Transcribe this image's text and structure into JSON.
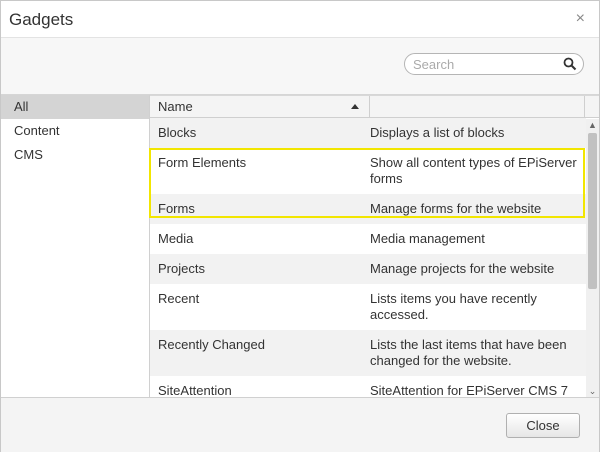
{
  "dialog": {
    "title": "Gadgets",
    "close_glyph": "×"
  },
  "search": {
    "placeholder": "Search",
    "value": ""
  },
  "sidebar": {
    "items": [
      {
        "label": "All",
        "active": true
      },
      {
        "label": "Content",
        "active": false
      },
      {
        "label": "CMS",
        "active": false
      }
    ]
  },
  "table": {
    "columns": {
      "name": "Name",
      "description": ""
    },
    "sort": "ascending",
    "rows": [
      {
        "name": "Blocks",
        "description": "Displays a list of blocks"
      },
      {
        "name": "Form Elements",
        "description": "Show all content types of EPiServer forms"
      },
      {
        "name": "Forms",
        "description": "Manage forms for the website"
      },
      {
        "name": "Media",
        "description": "Media management"
      },
      {
        "name": "Projects",
        "description": "Manage projects for the website"
      },
      {
        "name": "Recent",
        "description": "Lists items you have recently accessed."
      },
      {
        "name": "Recently Changed",
        "description": "Lists the last items that have been changed for the website."
      },
      {
        "name": "SiteAttention",
        "description": "SiteAttention for EPiServer CMS 7"
      }
    ]
  },
  "footer": {
    "close_label": "Close"
  },
  "colors": {
    "highlight": "#f2e600",
    "active_sidebar": "#d4d4d4"
  }
}
